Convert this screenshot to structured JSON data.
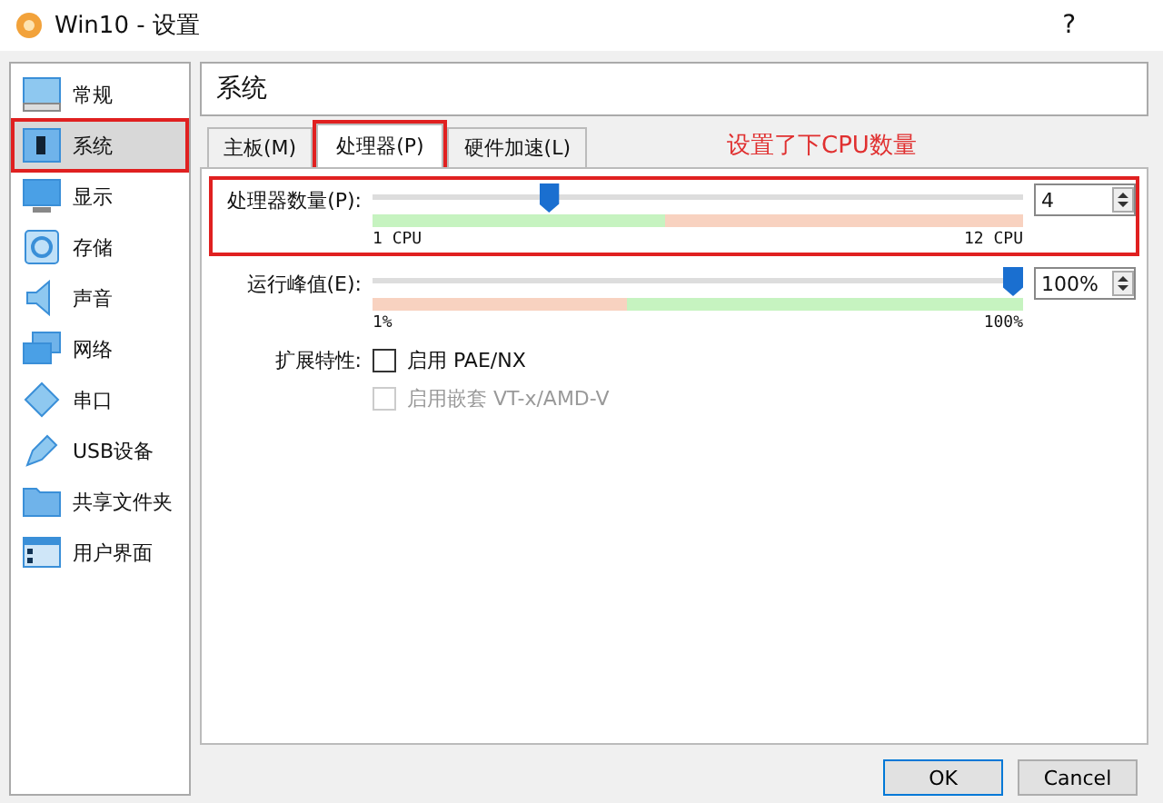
{
  "window": {
    "title": "Win10 - 设置",
    "help": "?"
  },
  "sidebar": {
    "items": [
      {
        "label": "常规",
        "kind": "general",
        "selected": false,
        "highlighted": false
      },
      {
        "label": "系统",
        "kind": "system",
        "selected": true,
        "highlighted": true
      },
      {
        "label": "显示",
        "kind": "display",
        "selected": false,
        "highlighted": false
      },
      {
        "label": "存储",
        "kind": "storage",
        "selected": false,
        "highlighted": false
      },
      {
        "label": "声音",
        "kind": "audio",
        "selected": false,
        "highlighted": false
      },
      {
        "label": "网络",
        "kind": "network",
        "selected": false,
        "highlighted": false
      },
      {
        "label": "串口",
        "kind": "serial",
        "selected": false,
        "highlighted": false
      },
      {
        "label": "USB设备",
        "kind": "usb",
        "selected": false,
        "highlighted": false
      },
      {
        "label": "共享文件夹",
        "kind": "folder",
        "selected": false,
        "highlighted": false
      },
      {
        "label": "用户界面",
        "kind": "ui",
        "selected": false,
        "highlighted": false
      }
    ]
  },
  "section_title": "系统",
  "tabs": [
    {
      "label": "主板(M)",
      "selected": false,
      "highlighted": false
    },
    {
      "label": "处理器(P)",
      "selected": true,
      "highlighted": true
    },
    {
      "label": "硬件加速(L)",
      "selected": false,
      "highlighted": false
    }
  ],
  "annotation": "设置了下CPU数量",
  "sliders": [
    {
      "label": "处理器数量(P):",
      "level": 0.27,
      "value": "4",
      "min_label": "1 CPU",
      "max_label": "12 CPU",
      "highlighted": true
    },
    {
      "label": "运行峰值(E):",
      "level": 1,
      "value": "100%",
      "min_label": "1%",
      "max_label": "100%",
      "highlighted": false
    }
  ],
  "features": {
    "label": "扩展特性:",
    "options": [
      {
        "label": "启用 PAE/NX",
        "checked": false,
        "disabled": false
      },
      {
        "label": "启用嵌套 VT-x/AMD-V",
        "checked": false,
        "disabled": true
      }
    ]
  },
  "buttons": [
    {
      "label": "OK",
      "default": true
    },
    {
      "label": "Cancel",
      "default": false
    }
  ]
}
